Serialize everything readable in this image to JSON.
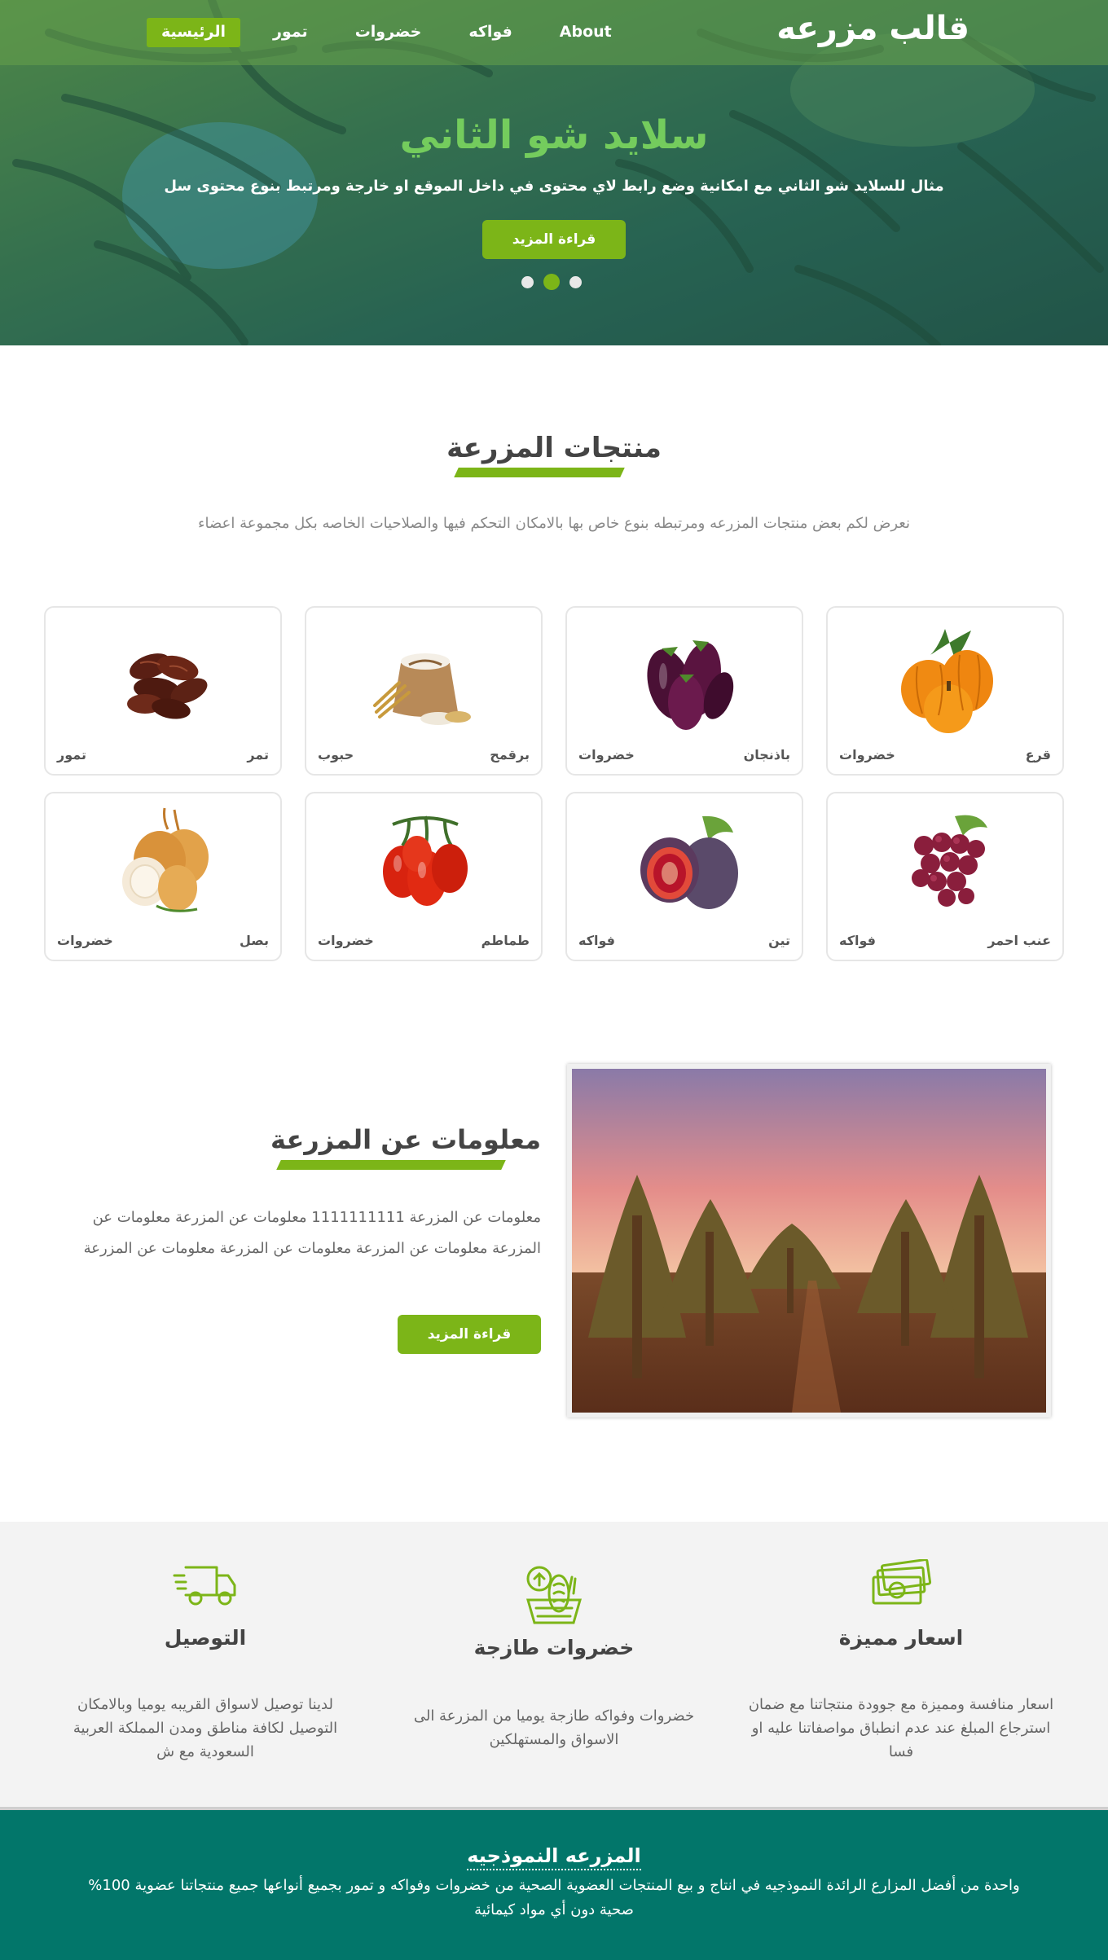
{
  "colors": {
    "accent": "#7cb518",
    "footer_bg": "#02766a",
    "hero_title": "#74cc5d"
  },
  "header": {
    "brand": "قالب مزرعه",
    "nav": [
      {
        "label": "الرئيسية",
        "active": true
      },
      {
        "label": "تمور"
      },
      {
        "label": "خضروات"
      },
      {
        "label": "فواكه"
      },
      {
        "label": "About"
      }
    ]
  },
  "hero": {
    "title": "سلايد شو الثاني",
    "description": "مثال للسلايد شو الثاني مع امكانية وضع رابط لاي محتوى في داخل الموقع او خارجة ومرتبط بنوع محتوى سل",
    "button": "قراءة المزيد",
    "slides_count": 3,
    "active_slide": 2
  },
  "products": {
    "title": "منتجات المزرعة",
    "subtitle": "نعرض لكم بعض منتجات المزرعه ومرتبطه بنوع خاص بها بالامكان التحكم فيها والصلاحيات الخاصه بكل مجموعة اعضاء",
    "items": [
      {
        "name": "قرع",
        "category": "خضروات",
        "icon": "pumpkin-icon"
      },
      {
        "name": "باذنجان",
        "category": "خضروات",
        "icon": "eggplant-icon"
      },
      {
        "name": "برقمح",
        "category": "حبوب",
        "icon": "wheat-sack-icon"
      },
      {
        "name": "تمر",
        "category": "تمور",
        "icon": "dates-icon"
      },
      {
        "name": "عنب احمر",
        "category": "فواكه",
        "icon": "grapes-icon"
      },
      {
        "name": "تين",
        "category": "فواكه",
        "icon": "fig-icon"
      },
      {
        "name": "طماطم",
        "category": "خضروات",
        "icon": "tomato-icon"
      },
      {
        "name": "بصل",
        "category": "خضروات",
        "icon": "onion-icon"
      }
    ]
  },
  "about": {
    "title": "معلومات عن المزرعة",
    "text": "معلومات عن المزرعة 1111111111 معلومات عن المزرعة معلومات عن المزرعة معلومات عن المزرعة معلومات عن المزرعة معلومات عن المزرعة",
    "button": "قراءة المزيد"
  },
  "features": [
    {
      "title": "اسعار مميزة",
      "text": "اسعار منافسة ومميزة مع جوودة منتجاتنا مع ضمان استرجاع المبلغ عند عدم انطباق مواصفاتنا عليه او فسا",
      "icon": "money-icon"
    },
    {
      "title": "خضروات طازجة",
      "text": "خضروات وفواكه طازجة يوميا من المزرعة الى الاسواق والمستهلكين",
      "icon": "vegetable-basket-icon"
    },
    {
      "title": "التوصيل",
      "text": "لدينا توصيل لاسواق القريبه يوميا وبالامكان التوصيل لكافة مناطق ومدن المملكة العربية السعودية مع ش",
      "icon": "delivery-truck-icon"
    }
  ],
  "footer": {
    "title": "المزرعه النموذجيه",
    "text": "واحدة من أفضل المزارع الرائدة النموذجيه في انتاج و بيع المنتجات العضوية الصحية من خضروات وفواكه و تمور بجميع أنواعها جميع منتجاتنا عضوية 100% صحية دون أي مواد كيمائية"
  }
}
